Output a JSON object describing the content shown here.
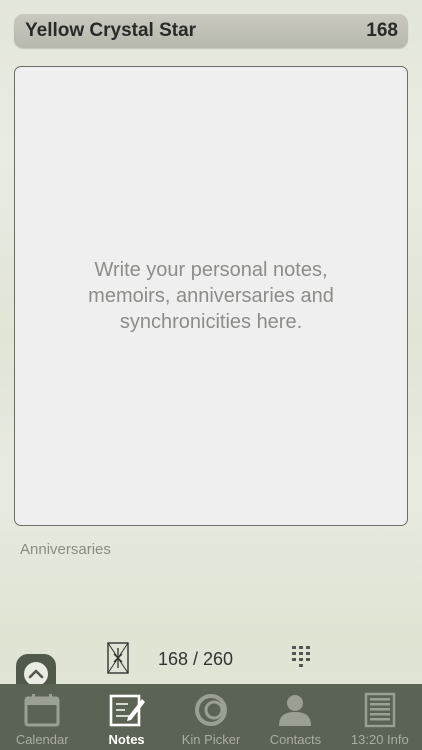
{
  "header": {
    "title": "Yellow Crystal Star",
    "kin_number": "168"
  },
  "notes": {
    "placeholder": "Write your personal notes, memoirs, anniversaries and synchronicities here."
  },
  "anniversaries_label": "Anniversaries",
  "pager": {
    "text": "168 / 260"
  },
  "tabs": [
    {
      "label": "Calendar",
      "icon": "calendar-icon"
    },
    {
      "label": "Notes",
      "icon": "notes-icon"
    },
    {
      "label": "Kin Picker",
      "icon": "kin-picker-icon"
    },
    {
      "label": "Contacts",
      "icon": "contacts-icon"
    },
    {
      "label": "13:20 Info",
      "icon": "info-list-icon"
    }
  ],
  "active_tab": "Notes",
  "colors": {
    "tabbar": "#5b6454",
    "header": "#bfc0b6",
    "background": "#e4e7dc",
    "active_tab_text": "#ffffff"
  }
}
